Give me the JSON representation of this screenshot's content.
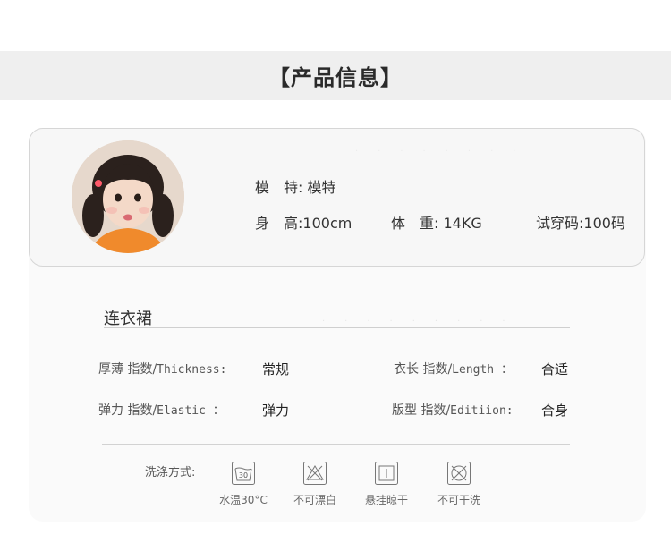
{
  "header": {
    "title": "【产品信息】"
  },
  "model": {
    "model_label": "模　特:",
    "model_value": "模特",
    "height_label": "身　高:",
    "height_value": "100cm",
    "weight_label": "体　重:",
    "weight_value": "14KG",
    "size_label": "试穿码:",
    "size_value": "100码"
  },
  "product": {
    "name": "连衣裙",
    "specs": {
      "thickness_cn": "厚薄 指数/",
      "thickness_en": "Thickness:",
      "thickness_value": "常规",
      "length_cn": "衣长 指数/",
      "length_en": "Length ：",
      "length_value": "合适",
      "elastic_cn": "弹力 指数/",
      "elastic_en": "Elastic ：",
      "elastic_value": "弹力",
      "edition_cn": "版型 指数/",
      "edition_en": "Editiion:",
      "edition_value": "合身"
    }
  },
  "washing": {
    "label": "洗涤方式:",
    "items": [
      {
        "icon": "wash-30-icon",
        "caption": "水温30°C",
        "temp": "30"
      },
      {
        "icon": "no-bleach-icon",
        "caption": "不可漂白"
      },
      {
        "icon": "hang-dry-icon",
        "caption": "悬挂晾干"
      },
      {
        "icon": "no-dry-clean-icon",
        "caption": "不可干洗"
      }
    ]
  }
}
